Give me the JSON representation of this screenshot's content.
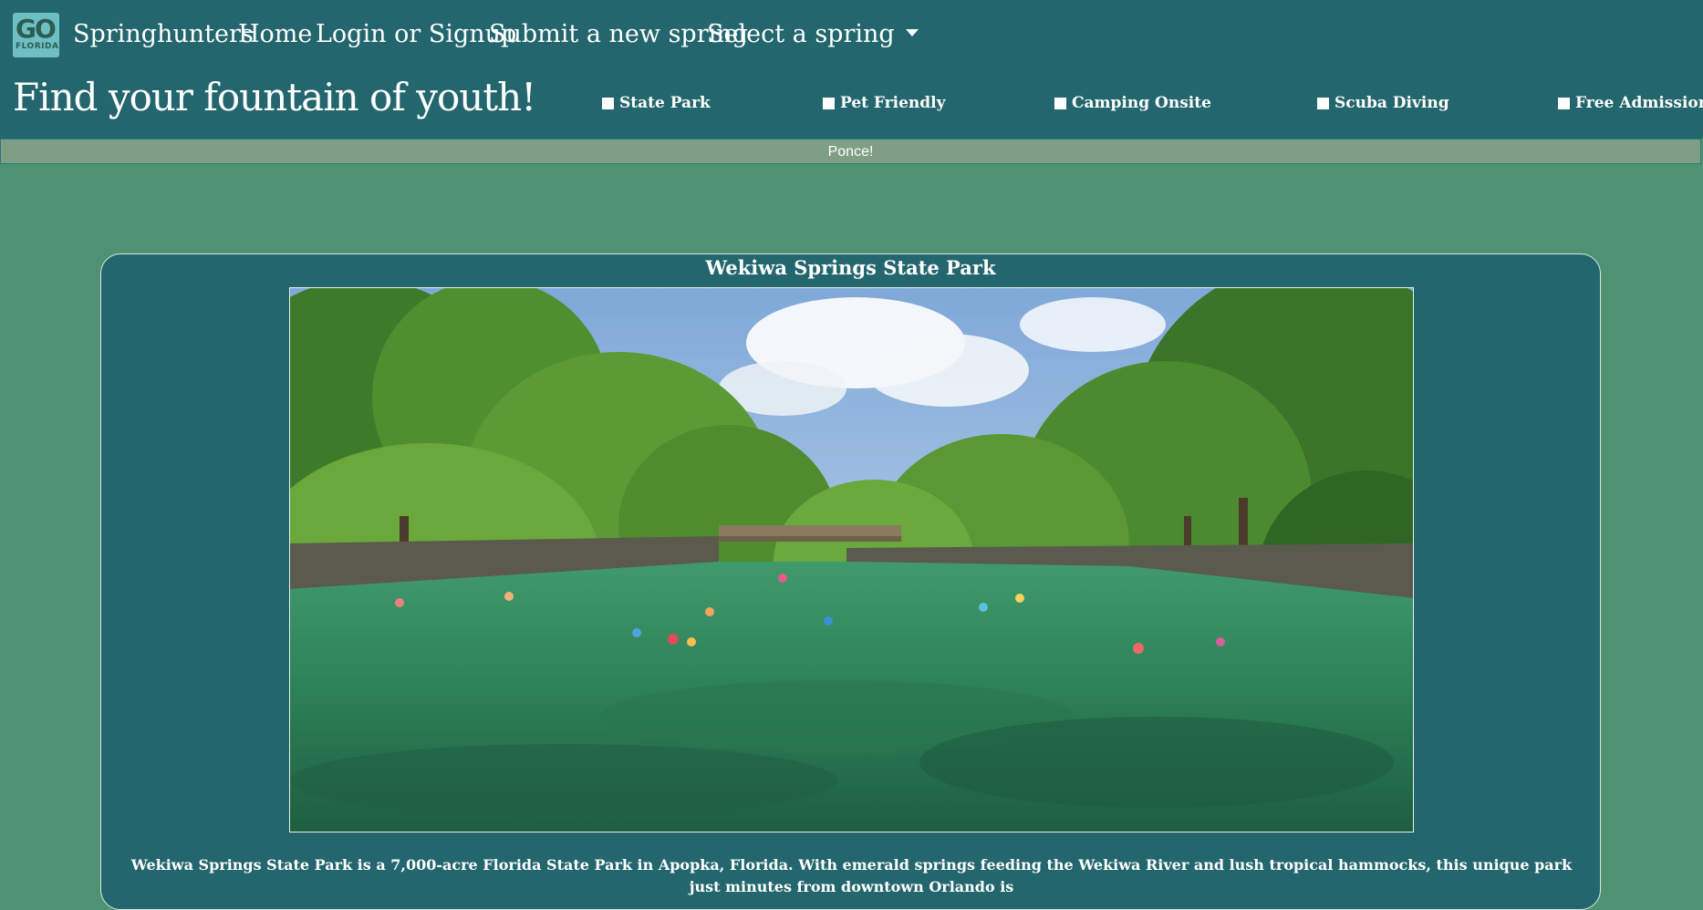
{
  "nav": {
    "logo_text_top": "GO",
    "logo_text_bottom": "FLORIDA",
    "brand": "Springhunters",
    "home": "Home",
    "login": "Login or Signup",
    "submit": "Submit a new spring",
    "select": "Select a spring"
  },
  "hero": {
    "headline": "Find your fountain of youth!"
  },
  "filters": [
    {
      "label": "State Park"
    },
    {
      "label": "Pet Friendly"
    },
    {
      "label": "Camping Onsite"
    },
    {
      "label": "Scuba Diving"
    },
    {
      "label": "Free Admission"
    }
  ],
  "search_button": "Ponce!",
  "card": {
    "title": "Wekiwa Springs State Park",
    "description": "Wekiwa Springs State Park is a 7,000-acre Florida State Park in Apopka, Florida. With emerald springs feeding the Wekiwa River and lush tropical hammocks, this unique park just minutes from downtown Orlando is"
  },
  "colors": {
    "header_bg": "#23666d",
    "page_bg": "#4f9271",
    "button_bg": "#7f9f85"
  }
}
